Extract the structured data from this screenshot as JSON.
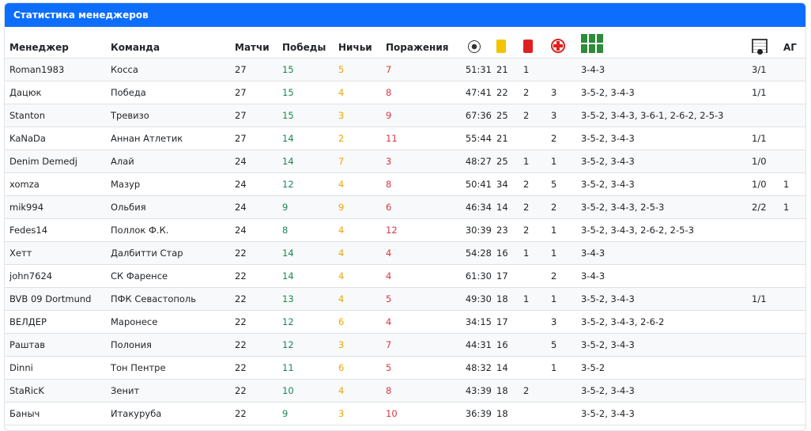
{
  "panel": {
    "title": "Статистика менеджеров"
  },
  "columns": {
    "manager": "Менеджер",
    "team": "Команда",
    "matches": "Матчи",
    "wins": "Победы",
    "draws": "Ничьи",
    "losses": "Поражения",
    "ag": "АГ"
  },
  "icons": [
    "ball-icon",
    "yellow-card-icon",
    "red-card-icon",
    "medical-cross-icon",
    "formation-field-icon",
    "goalkeeper-goal-icon"
  ],
  "colors": {
    "header": "#0d6efd",
    "win": "#198754",
    "draw": "#f0a500",
    "loss": "#dc3545"
  },
  "rows": [
    {
      "manager": "Roman1983",
      "team": "Косса",
      "matches": "27",
      "wins": "15",
      "draws": "5",
      "losses": "7",
      "goals": "51:31",
      "yellow": "21",
      "red": "1",
      "injuries": "",
      "formations": "3-4-3",
      "gk": "3/1",
      "ag": ""
    },
    {
      "manager": "Дацюк",
      "team": "Победа",
      "matches": "27",
      "wins": "15",
      "draws": "4",
      "losses": "8",
      "goals": "47:41",
      "yellow": "22",
      "red": "2",
      "injuries": "3",
      "formations": "3-5-2, 3-4-3",
      "gk": "1/1",
      "ag": ""
    },
    {
      "manager": "Stanton",
      "team": "Тревизо",
      "matches": "27",
      "wins": "15",
      "draws": "3",
      "losses": "9",
      "goals": "67:36",
      "yellow": "25",
      "red": "2",
      "injuries": "3",
      "formations": "3-5-2, 3-4-3, 3-6-1, 2-6-2, 2-5-3",
      "gk": "",
      "ag": ""
    },
    {
      "manager": "KaNaDa",
      "team": "Аннан Атлетик",
      "matches": "27",
      "wins": "14",
      "draws": "2",
      "losses": "11",
      "goals": "55:44",
      "yellow": "21",
      "red": "",
      "injuries": "2",
      "formations": "3-5-2, 3-4-3",
      "gk": "1/1",
      "ag": ""
    },
    {
      "manager": "Denim Demedj",
      "team": "Алай",
      "matches": "24",
      "wins": "14",
      "draws": "7",
      "losses": "3",
      "goals": "48:27",
      "yellow": "25",
      "red": "1",
      "injuries": "1",
      "formations": "3-5-2, 3-4-3",
      "gk": "1/0",
      "ag": ""
    },
    {
      "manager": "xomza",
      "team": "Мазур",
      "matches": "24",
      "wins": "12",
      "draws": "4",
      "losses": "8",
      "goals": "50:41",
      "yellow": "34",
      "red": "2",
      "injuries": "5",
      "formations": "3-5-2, 3-4-3",
      "gk": "1/0",
      "ag": "1"
    },
    {
      "manager": "mik994",
      "team": "Ольбия",
      "matches": "24",
      "wins": "9",
      "draws": "9",
      "losses": "6",
      "goals": "46:34",
      "yellow": "14",
      "red": "2",
      "injuries": "2",
      "formations": "3-5-2, 3-4-3, 2-5-3",
      "gk": "2/2",
      "ag": "1"
    },
    {
      "manager": "Fedes14",
      "team": "Поллок Ф.К.",
      "matches": "24",
      "wins": "8",
      "draws": "4",
      "losses": "12",
      "goals": "30:39",
      "yellow": "23",
      "red": "2",
      "injuries": "1",
      "formations": "3-5-2, 3-4-3, 2-6-2, 2-5-3",
      "gk": "",
      "ag": ""
    },
    {
      "manager": "Хетт",
      "team": "Далбитти Стар",
      "matches": "22",
      "wins": "14",
      "draws": "4",
      "losses": "4",
      "goals": "54:28",
      "yellow": "16",
      "red": "1",
      "injuries": "1",
      "formations": "3-4-3",
      "gk": "",
      "ag": ""
    },
    {
      "manager": "john7624",
      "team": "СК Фаренсе",
      "matches": "22",
      "wins": "14",
      "draws": "4",
      "losses": "4",
      "goals": "61:30",
      "yellow": "17",
      "red": "",
      "injuries": "2",
      "formations": "3-4-3",
      "gk": "",
      "ag": ""
    },
    {
      "manager": "BVB 09 Dortmund",
      "team": "ПФК Севастополь",
      "matches": "22",
      "wins": "13",
      "draws": "4",
      "losses": "5",
      "goals": "49:30",
      "yellow": "18",
      "red": "1",
      "injuries": "1",
      "formations": "3-5-2, 3-4-3",
      "gk": "1/1",
      "ag": ""
    },
    {
      "manager": "ВЕЛДЕР",
      "team": "Маронесе",
      "matches": "22",
      "wins": "12",
      "draws": "6",
      "losses": "4",
      "goals": "34:15",
      "yellow": "17",
      "red": "",
      "injuries": "3",
      "formations": "3-5-2, 3-4-3, 2-6-2",
      "gk": "",
      "ag": ""
    },
    {
      "manager": "Раштав",
      "team": "Полония",
      "matches": "22",
      "wins": "12",
      "draws": "3",
      "losses": "7",
      "goals": "44:31",
      "yellow": "16",
      "red": "",
      "injuries": "5",
      "formations": "3-5-2, 3-4-3",
      "gk": "",
      "ag": ""
    },
    {
      "manager": "Dinni",
      "team": "Тон Пентре",
      "matches": "22",
      "wins": "11",
      "draws": "6",
      "losses": "5",
      "goals": "48:32",
      "yellow": "14",
      "red": "",
      "injuries": "1",
      "formations": "3-5-2",
      "gk": "",
      "ag": ""
    },
    {
      "manager": "StaRicK",
      "team": "Зенит",
      "matches": "22",
      "wins": "10",
      "draws": "4",
      "losses": "8",
      "goals": "43:39",
      "yellow": "18",
      "red": "2",
      "injuries": "",
      "formations": "3-5-2, 3-4-3",
      "gk": "",
      "ag": ""
    },
    {
      "manager": "Баныч",
      "team": "Итакуруба",
      "matches": "22",
      "wins": "9",
      "draws": "3",
      "losses": "10",
      "goals": "36:39",
      "yellow": "18",
      "red": "",
      "injuries": "",
      "formations": "3-5-2, 3-4-3",
      "gk": "",
      "ag": ""
    }
  ]
}
